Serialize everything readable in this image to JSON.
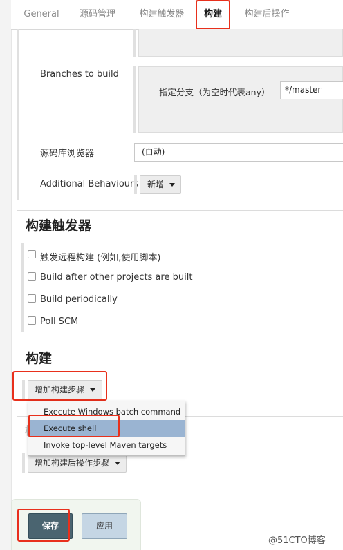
{
  "tabs": [
    {
      "label": "General"
    },
    {
      "label": "源码管理"
    },
    {
      "label": "构建触发器"
    },
    {
      "label": "构建"
    },
    {
      "label": "构建后操作"
    }
  ],
  "scm": {
    "branches_label": "Branches to build",
    "branch_specifier_label": "指定分支（为空时代表any）",
    "branch_specifier_value": "*/master",
    "repo_browser_label": "源码库浏览器",
    "repo_browser_value": "(自动)",
    "additional_behaviours_label": "Additional Behaviours",
    "add_button_label": "新增"
  },
  "triggers": {
    "heading": "构建触发器",
    "options": [
      {
        "label": "触发远程构建 (例如,使用脚本)",
        "checked": false
      },
      {
        "label": "Build after other projects are built",
        "checked": false
      },
      {
        "label": "Build periodically",
        "checked": false
      },
      {
        "label": "Poll SCM",
        "checked": false
      }
    ]
  },
  "build": {
    "heading": "构建",
    "add_step_label": "增加构建步骤",
    "menu_items": [
      {
        "label": "Execute Windows batch command"
      },
      {
        "label": "Execute shell"
      },
      {
        "label": "Invoke top-level Maven targets"
      }
    ],
    "highlighted_item": "Execute shell"
  },
  "post_build": {
    "add_step_label": "增加构建后操作步骤"
  },
  "footer": {
    "save_label": "保存",
    "apply_label": "应用"
  },
  "watermark": "@51CTO博客",
  "colors": {
    "highlight_red": "#e8301c",
    "menu_highlight": "#9ab4d2",
    "save_button": "#4a6470",
    "apply_button": "#c5d6e4"
  }
}
